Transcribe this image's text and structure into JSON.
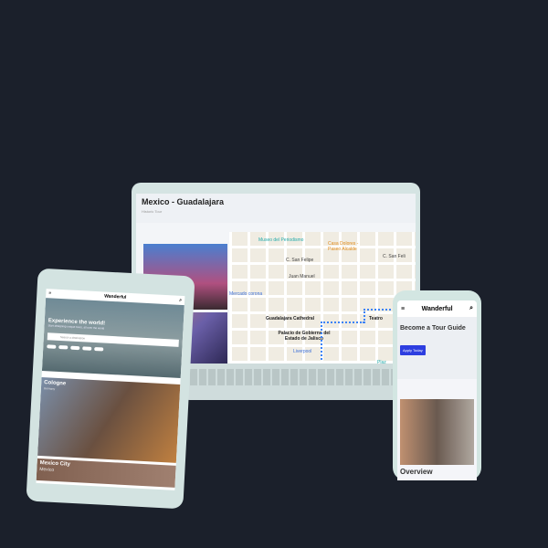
{
  "laptop": {
    "title": "Mexico - Guadalajara",
    "subtitle": "Historic Tour",
    "map_labels": [
      "Museo del Periodismo",
      "Casa Dolores - Paseo Alcalde",
      "C. San Felipe",
      "C. San Feli",
      "Juan Manuel",
      "Mercado corona",
      "Guadalajara Cathedral",
      "Teatro",
      "Palacio de Gobierno del Estado de Jalisco",
      "Liverpool",
      "Plaz"
    ]
  },
  "tablet": {
    "brand": "Wanderful",
    "hero_title": "Experience the world!",
    "hero_sub": "Start designing unique tours, all over the world",
    "search_placeholder": "Search a destination",
    "cards": [
      {
        "title": "Cologne",
        "sub": "Germany"
      },
      {
        "title": "Mexico City",
        "sub": "Mexico"
      }
    ]
  },
  "phone": {
    "brand": "Wanderful",
    "heading": "Become a Tour Guide",
    "apply_label": "Apply Today",
    "overview": "Overview"
  },
  "colors": {
    "background": "#1b202b",
    "accent": "#2d3ee0",
    "route": "#3b82f6"
  }
}
